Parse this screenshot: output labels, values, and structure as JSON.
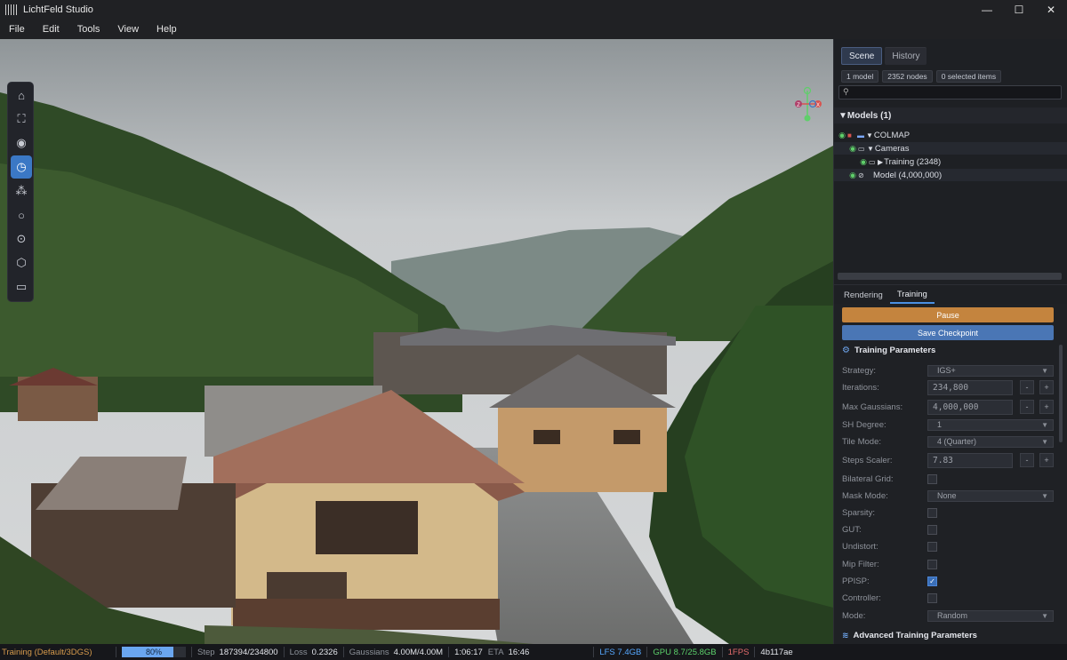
{
  "window": {
    "title": "LichtFeld Studio",
    "minimize": "—",
    "maximize": "☐",
    "close": "✕"
  },
  "menu": [
    "File",
    "Edit",
    "Tools",
    "View",
    "Help"
  ],
  "toolbar": [
    {
      "name": "home-icon",
      "glyph": "⌂"
    },
    {
      "name": "frame-select-icon",
      "glyph": "⛶"
    },
    {
      "name": "visibility-icon",
      "glyph": "◉"
    },
    {
      "name": "clock-icon",
      "glyph": "◷"
    },
    {
      "name": "nodes-icon",
      "glyph": "⁂"
    },
    {
      "name": "circle-select-icon",
      "glyph": "○"
    },
    {
      "name": "point-select-icon",
      "glyph": "⊙"
    },
    {
      "name": "cube-icon",
      "glyph": "⬡"
    },
    {
      "name": "camera-icon",
      "glyph": "▭"
    }
  ],
  "scene_panel": {
    "tabs": [
      "Scene",
      "History"
    ],
    "chips": [
      "1 model",
      "2352 nodes",
      "0 selected items"
    ],
    "search_placeholder": "",
    "models_header": "▼Models (1)",
    "tree": {
      "colmap": "COLMAP",
      "cameras": "Cameras",
      "training": "Training (2348)",
      "model": "Model (4,000,000)"
    }
  },
  "training_panel": {
    "tabs": [
      "Rendering",
      "Training"
    ],
    "pause": "Pause",
    "save_checkpoint": "Save Checkpoint",
    "params_title": "Training Parameters",
    "strategy": {
      "label": "Strategy:",
      "value": "IGS+"
    },
    "iterations": {
      "label": "Iterations:",
      "value": "234,800"
    },
    "max_gaussians": {
      "label": "Max Gaussians:",
      "value": "4,000,000"
    },
    "sh_degree": {
      "label": "SH Degree:",
      "value": "1"
    },
    "tile_mode": {
      "label": "Tile Mode:",
      "value": "4 (Quarter)"
    },
    "steps_scaler": {
      "label": "Steps Scaler:",
      "value": "7.83"
    },
    "bilateral_grid": {
      "label": "Bilateral Grid:"
    },
    "mask_mode": {
      "label": "Mask Mode:",
      "value": "None"
    },
    "sparsity": {
      "label": "Sparsity:"
    },
    "gut": {
      "label": "GUT:"
    },
    "undistort": {
      "label": "Undistort:"
    },
    "mip_filter": {
      "label": "Mip Filter:"
    },
    "ppisp": {
      "label": "PPISP:",
      "checked": true
    },
    "controller": {
      "label": "Controller:"
    },
    "mode": {
      "label": "Mode:",
      "value": "Random"
    },
    "advanced_title": "Advanced Training Parameters",
    "minus": "-",
    "plus": "+"
  },
  "status": {
    "mode": "Training (Default/3DGS)",
    "progress_text": "80%",
    "progress": 0.8,
    "step_label": "Step",
    "step_value": "187394/234800",
    "loss_label": "Loss",
    "loss_value": "0.2326",
    "gaussians_label": "Gaussians",
    "gaussians_value": "4.00M/4.00M",
    "elapsed": "1:06:17",
    "eta_label": "ETA",
    "eta_value": "16:46",
    "lfs": "LFS 7.4GB",
    "gpu": "GPU 8.7/25.8GB",
    "fps": "1FPS",
    "hash": "4b117ae"
  },
  "colors": {
    "accent": "#3b78c5",
    "pause": "#c4843e",
    "save": "#4a76b5",
    "status_mode": "#d59a4c",
    "lfs": "#56a8ff",
    "gpu": "#5cd16b",
    "fps": "#e36c6c"
  },
  "gizmo": {
    "z": "Z",
    "x": "X"
  }
}
